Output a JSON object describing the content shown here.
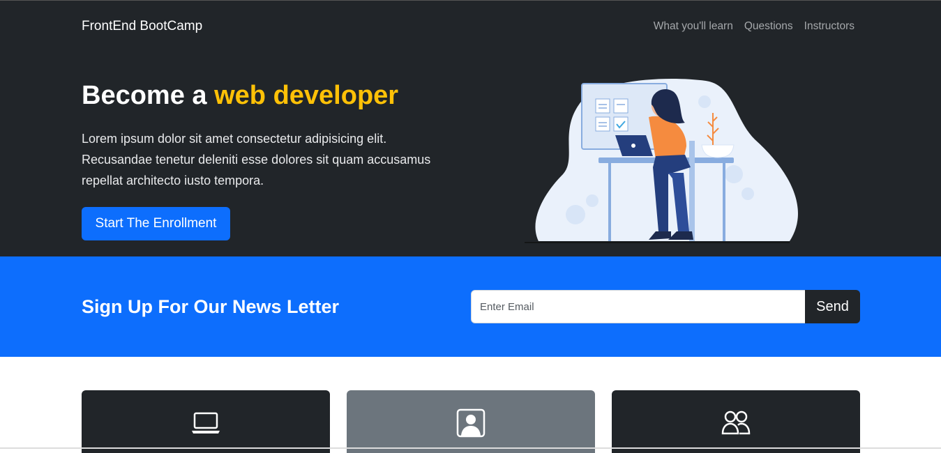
{
  "navbar": {
    "brand": "FrontEnd BootCamp",
    "links": [
      "What you'll learn",
      "Questions",
      "Instructors"
    ]
  },
  "hero": {
    "title_prefix": "Become a",
    "title_accent": "web developer",
    "text": "Lorem ipsum dolor sit amet consectetur adipisicing elit. Recusandae tenetur deleniti esse dolores sit quam accusamus repellat architecto iusto tempora.",
    "button_label": "Start The Enrollment"
  },
  "newsletter": {
    "title": "Sign Up For Our News Letter",
    "email_placeholder": "Enter Email",
    "email_value": "",
    "send_label": "Send"
  },
  "cards": [
    {
      "icon": "laptop-icon"
    },
    {
      "icon": "person-square-icon"
    },
    {
      "icon": "people-icon"
    }
  ],
  "colors": {
    "dark": "#212529",
    "primary": "#0d6efd",
    "accent": "#ffc107",
    "secondary": "#6c757d"
  }
}
